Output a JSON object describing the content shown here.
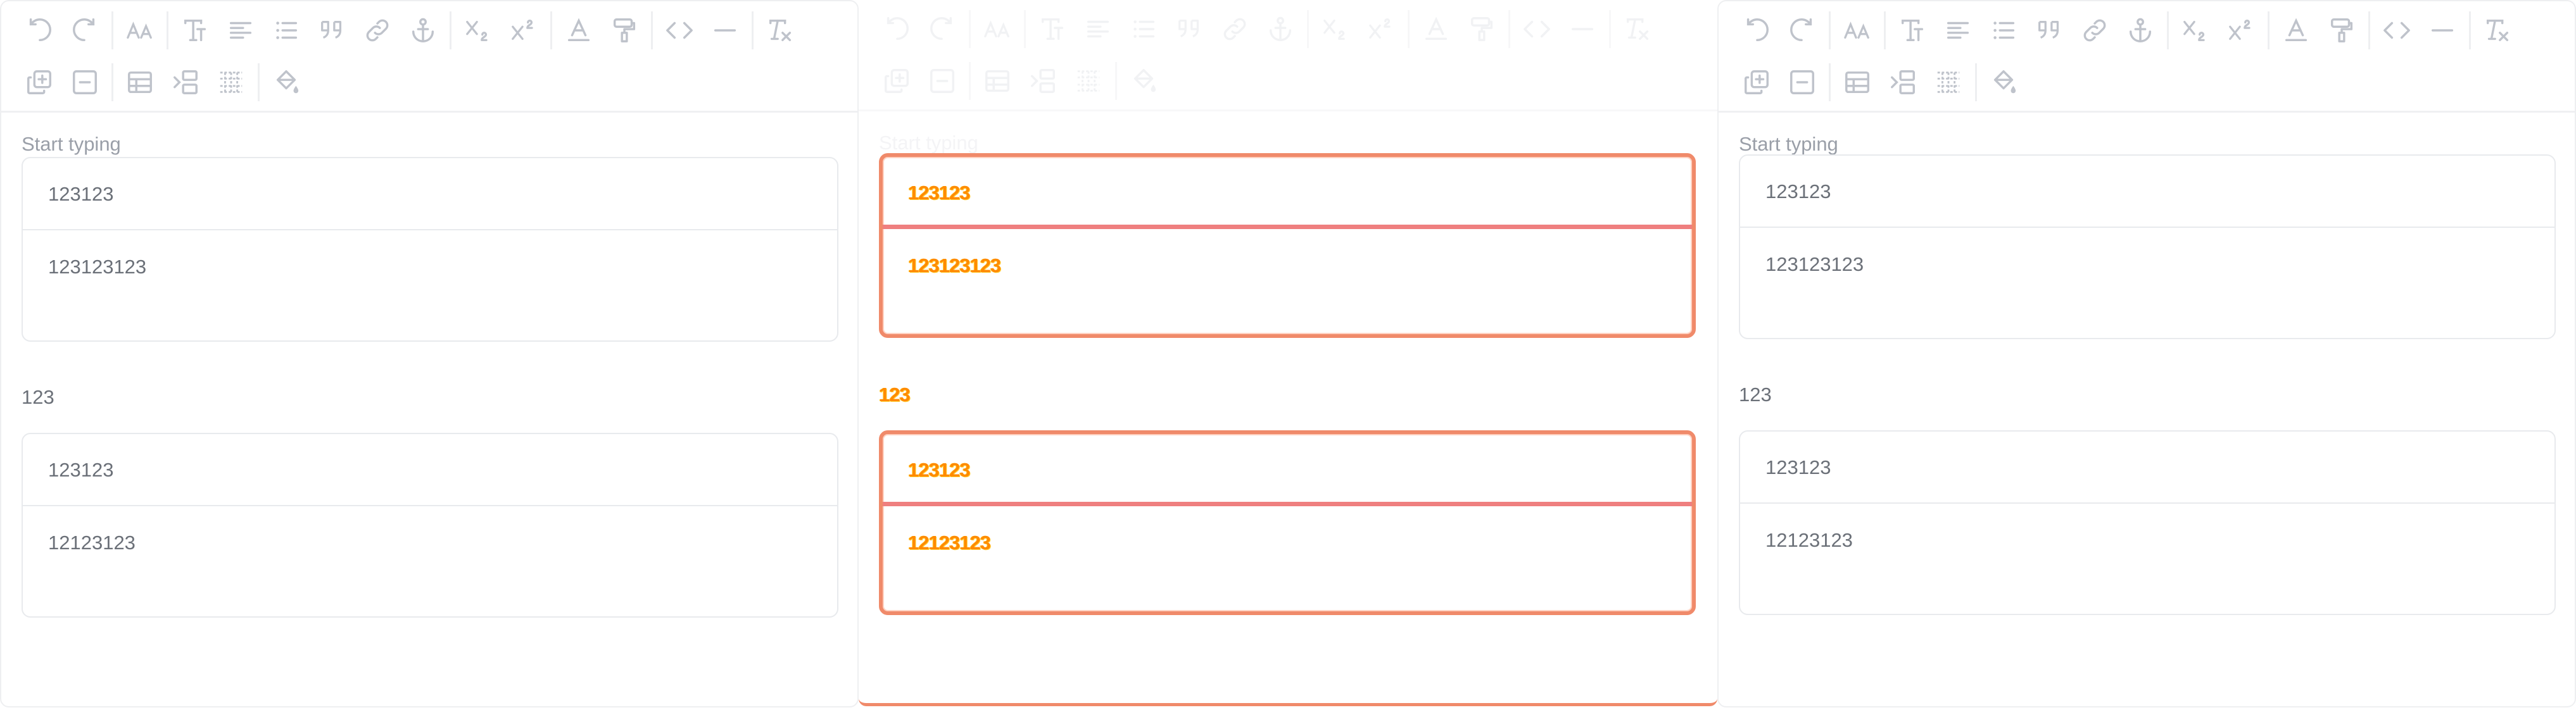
{
  "toolbar": {
    "row1": [
      "undo-icon",
      "redo-icon",
      "|",
      "font-size-icon",
      "|",
      "heading-icon",
      "align-icon",
      "bullet-list-icon",
      "blockquote-icon",
      "link-icon",
      "anchor-icon",
      "|",
      "subscript-icon",
      "superscript-icon",
      "|",
      "text-color-icon",
      "format-painter-icon",
      "|",
      "code-icon",
      "horizontal-rule-icon",
      "|",
      "clear-format-icon"
    ],
    "row2": [
      "add-row-icon",
      "delete-row-icon",
      "|",
      "insert-table-icon",
      "table-indent-icon",
      "table-columns-icon",
      "|",
      "fill-color-icon"
    ]
  },
  "panels": {
    "left": {
      "placeholder": "Start typing",
      "table1": {
        "row1": "123123",
        "row2": "123123123"
      },
      "paragraph": "123",
      "table2": {
        "row1": "123123",
        "row2": "12123123"
      }
    },
    "middle": {
      "placeholder": "Start typing",
      "table1": {
        "row1": "123123",
        "row2": "123123123"
      },
      "paragraph": "123",
      "table2": {
        "row1": "123123",
        "row2": "12123123"
      }
    },
    "right": {
      "placeholder": "Start typing",
      "table1": {
        "row1": "123123",
        "row2": "123123123"
      },
      "paragraph": "123",
      "table2": {
        "row1": "123123",
        "row2": "12123123"
      }
    }
  },
  "colors": {
    "diff_border": "#f08a6a",
    "diff_text": "#ff8a00",
    "icon": "#bfc3cb",
    "text": "#6b7078"
  }
}
